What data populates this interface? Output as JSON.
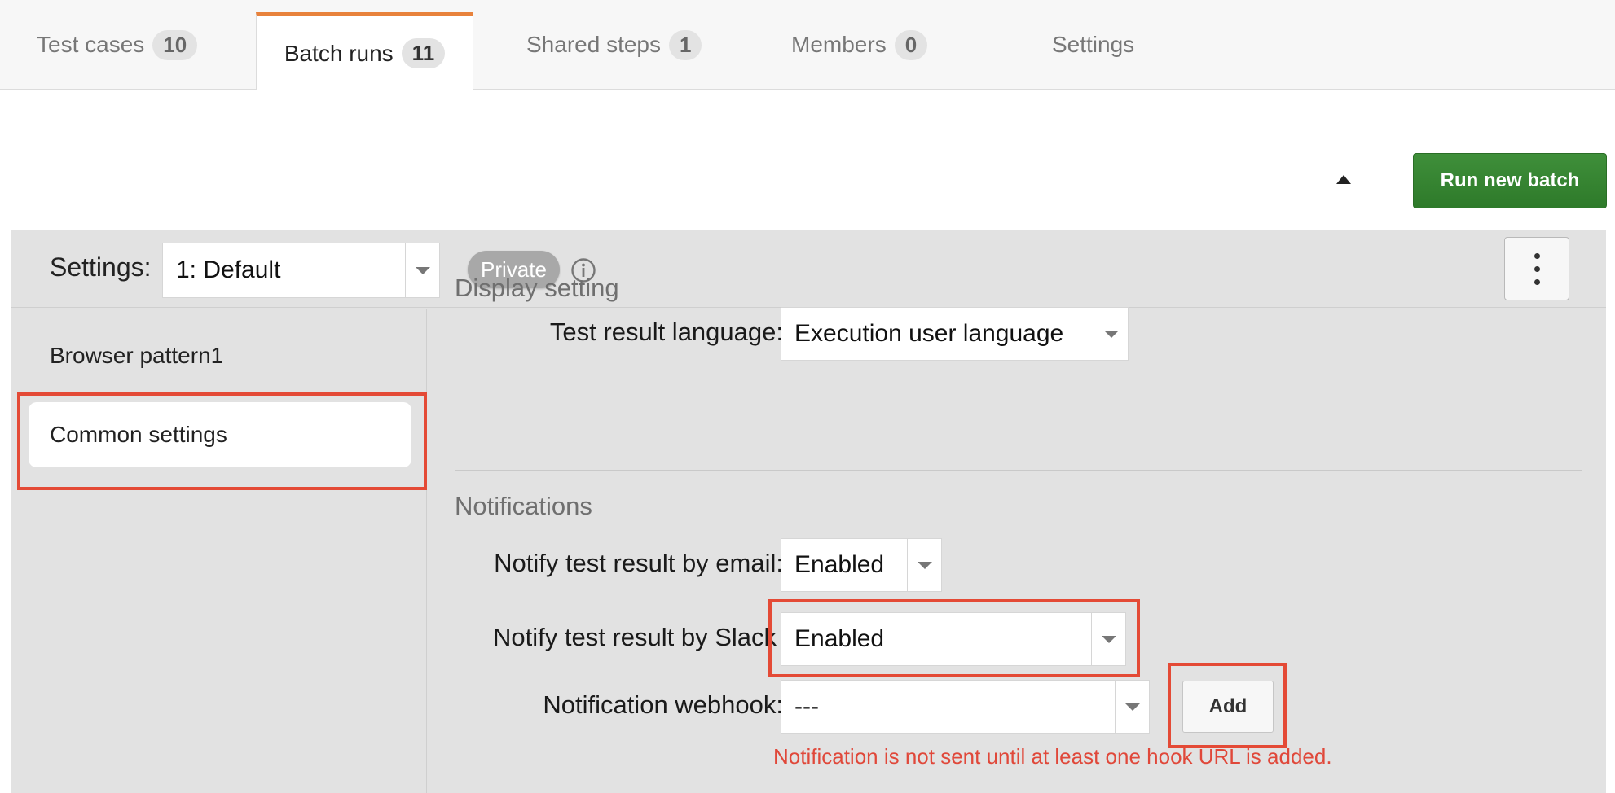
{
  "tabs": [
    {
      "label": "Test cases",
      "count": "10"
    },
    {
      "label": "Batch runs",
      "count": "11",
      "active": true
    },
    {
      "label": "Shared steps",
      "count": "1"
    },
    {
      "label": "Members",
      "count": "0"
    },
    {
      "label": "Settings"
    }
  ],
  "toolbar": {
    "collapse_icon": "triangle-up-icon",
    "run_button": "Run new batch"
  },
  "settings_bar": {
    "label": "Settings:",
    "selected": "1: Default",
    "badge": "Private",
    "info_icon": "info-icon",
    "menu_icon": "kebab-menu-icon"
  },
  "sidebar": {
    "items": [
      {
        "label": "Browser pattern1"
      },
      {
        "label": "Common settings",
        "selected": true
      }
    ]
  },
  "display_setting": {
    "title": "Display setting",
    "language_label": "Test result language:",
    "language_value": "Execution user language"
  },
  "notifications": {
    "title": "Notifications",
    "email_label": "Notify test result by email:",
    "email_value": "Enabled",
    "slack_label": "Notify test result by Slack",
    "slack_value": "Enabled",
    "webhook_label": "Notification webhook:",
    "webhook_value": "---",
    "add_button": "Add",
    "warning": "Notification is not sent until at least one hook URL is added."
  },
  "colors": {
    "accent_tab": "#e8823c",
    "run_button": "#2e7a2a",
    "highlight": "#e44a36",
    "warning": "#e0483a"
  }
}
